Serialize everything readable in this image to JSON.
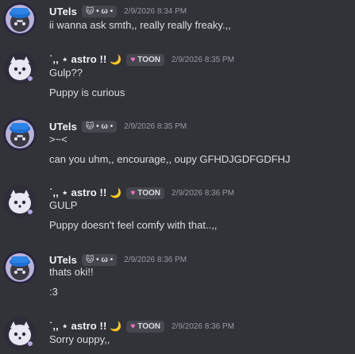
{
  "colors": {
    "background": "#323339",
    "username": "#f2f3f5",
    "text": "#dbdee1",
    "timestamp": "#949ba4",
    "tag_bg": "#45474e",
    "tag_icon": "#ff73c7"
  },
  "users": {
    "utels": {
      "name": "UTels",
      "tag_label": "🐱 • ω •",
      "avatar_icon": "blue-hat-character-avatar"
    },
    "astro": {
      "name": "˙,, ⋆ astro !!",
      "moon": "🌙",
      "tag_icon": "♥",
      "tag_label": "TOON",
      "avatar_icon": "ghost-puppy-avatar"
    }
  },
  "messages": [
    {
      "user": "UTels",
      "time": "2/9/2026 8:34 PM",
      "lines": [
        "ii wanna ask smth,, really really freaky.,,"
      ]
    },
    {
      "user": "astro",
      "time": "2/9/2026 8:35 PM",
      "lines": [
        "Gulp??",
        "Puppy is curious"
      ]
    },
    {
      "user": "UTels",
      "time": "2/9/2026 8:35 PM",
      "lines": [
        ">~<",
        "can you uhm,, encourage,, oupy GFHDJGDFGDFHJ"
      ]
    },
    {
      "user": "astro",
      "time": "2/9/2026 8:36 PM",
      "lines": [
        "GULP",
        "Puppy doesn't feel comfy with that..,,"
      ]
    },
    {
      "user": "UTels",
      "time": "2/9/2026 8:36 PM",
      "lines": [
        "thats oki!!",
        ":3"
      ]
    },
    {
      "user": "astro",
      "time": "2/9/2026 8:36 PM",
      "lines": [
        "Sorry ouppy,,"
      ]
    }
  ]
}
